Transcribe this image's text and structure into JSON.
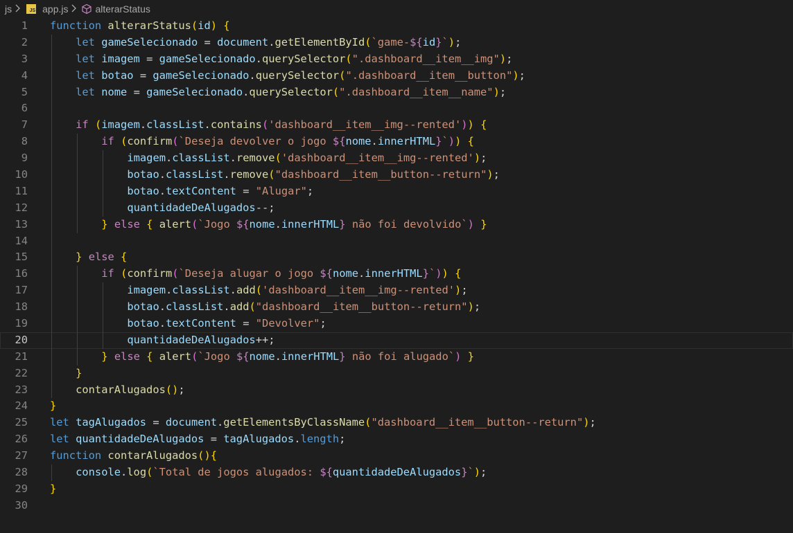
{
  "breadcrumb": {
    "folder": "js",
    "file": "app.js",
    "file_badge": "JS",
    "symbol": "alterarStatus"
  },
  "editor": {
    "current_line": 20,
    "line_numbers": [
      "1",
      "2",
      "3",
      "4",
      "5",
      "6",
      "7",
      "8",
      "9",
      "10",
      "11",
      "12",
      "13",
      "14",
      "15",
      "16",
      "17",
      "18",
      "19",
      "20",
      "21",
      "22",
      "23",
      "24",
      "25",
      "26",
      "27",
      "28",
      "29",
      "30"
    ],
    "lines": [
      "function alterarStatus(id) {",
      "    let gameSelecionado = document.getElementById(`game-${id}`);",
      "    let imagem = gameSelecionado.querySelector(\".dashboard__item__img\");",
      "    let botao = gameSelecionado.querySelector(\".dashboard__item__button\");",
      "    let nome = gameSelecionado.querySelector(\".dashboard__item__name\");",
      "",
      "    if (imagem.classList.contains('dashboard__item__img--rented')) {",
      "        if (confirm(`Deseja devolver o jogo ${nome.innerHTML}`)) {",
      "            imagem.classList.remove('dashboard__item__img--rented');",
      "            botao.classList.remove(\"dashboard__item__button--return\");",
      "            botao.textContent = \"Alugar\";",
      "            quantidadeDeAlugados--;",
      "        } else { alert(`Jogo ${nome.innerHTML} não foi devolvido`) }",
      "",
      "    } else {",
      "        if (confirm(`Deseja alugar o jogo ${nome.innerHTML}`)) {",
      "            imagem.classList.add('dashboard__item__img--rented');",
      "            botao.classList.add(\"dashboard__item__button--return\");",
      "            botao.textContent = \"Devolver\";",
      "            quantidadeDeAlugados++;",
      "        } else { alert(`Jogo ${nome.innerHTML} não foi alugado`) }",
      "    }",
      "    contarAlugados();",
      "}",
      "let tagAlugados = document.getElementsByClassName(\"dashboard__item__button--return\");",
      "let quantidadeDeAlugados = tagAlugados.length;",
      "function contarAlugados(){",
      "    console.log(`Total de jogos alugados: ${quantidadeDeAlugados}`);",
      "}",
      ""
    ]
  },
  "colors": {
    "background": "#1e1e1e",
    "keyword": "#569cd6",
    "control": "#c586c0",
    "function": "#dcdcaa",
    "variable": "#9cdcfe",
    "string": "#ce9178",
    "line_number": "#858585"
  },
  "icons": [
    "chevron-right-icon",
    "js-file-icon",
    "cube-symbol-icon"
  ]
}
